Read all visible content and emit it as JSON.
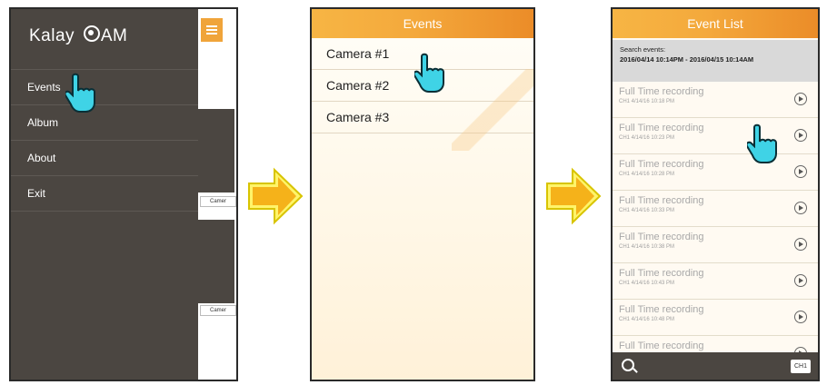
{
  "panel1": {
    "logo_text": "Kalay",
    "logo_suffix": "AM",
    "menu": [
      "Events",
      "Album",
      "About",
      "Exit"
    ],
    "thumb_label": "Camer"
  },
  "panel2": {
    "title": "Events",
    "cameras": [
      "Camera #1",
      "Camera #2",
      "Camera #3"
    ]
  },
  "panel3": {
    "title": "Event List",
    "search_label": "Search events:",
    "search_range": "2016/04/14 10:14PM - 2016/04/15 10:14AM",
    "events": [
      {
        "title": "Full Time recording",
        "sub": "CH1  4/14/16 10:18 PM"
      },
      {
        "title": "Full Time recording",
        "sub": "CH1  4/14/16 10:23 PM"
      },
      {
        "title": "Full Time recording",
        "sub": "CH1  4/14/16 10:28 PM"
      },
      {
        "title": "Full Time recording",
        "sub": "CH1  4/14/16 10:33 PM"
      },
      {
        "title": "Full Time recording",
        "sub": "CH1  4/14/16 10:38 PM"
      },
      {
        "title": "Full Time recording",
        "sub": "CH1  4/14/16 10:43 PM"
      },
      {
        "title": "Full Time recording",
        "sub": "CH1  4/14/16 10:48 PM"
      },
      {
        "title": "Full Time recording",
        "sub": ""
      }
    ],
    "channel_badge": "CH1"
  },
  "icons": [
    "menu-icon",
    "camera-lens-icon",
    "search-icon",
    "play-icon",
    "hand-pointer-icon",
    "arrow-right-icon"
  ],
  "colors": {
    "accent": "#f4a93c",
    "drawer": "#4b4641",
    "arrow_fill": "#f5b21a",
    "hand": "#3fd3e6"
  }
}
